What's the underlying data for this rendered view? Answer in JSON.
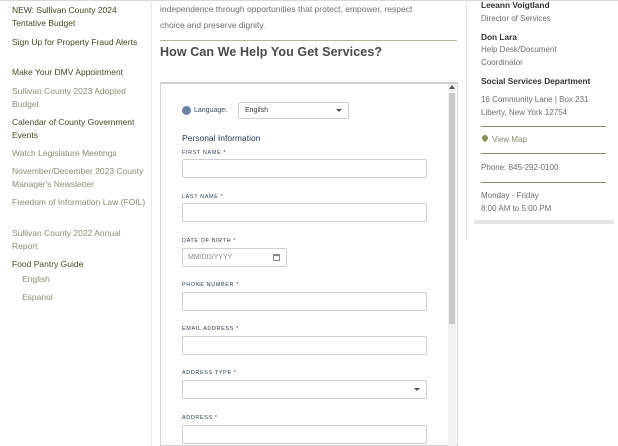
{
  "sidebar": {
    "items": [
      {
        "label": "NEW: Sullivan County 2024 Tentative Budget",
        "style": "dark"
      },
      {
        "label": "Sign Up for Property Fraud Alerts",
        "style": "dark"
      },
      {
        "label": "Make Your DMV Appointment",
        "style": "dark"
      },
      {
        "label": "Sullivan County 2023 Adopted Budget",
        "style": "light"
      },
      {
        "label": "Calendar of County Government Events",
        "style": "dark"
      },
      {
        "label": "Watch Legislature Meetings",
        "style": "light"
      },
      {
        "label": "November/December 2023 County Manager's Newsletter",
        "style": "light"
      },
      {
        "label": "Freedom of Information Law (FOIL)",
        "style": "light"
      },
      {
        "label": "Sullivan County 2022 Annual Report",
        "style": "light"
      },
      {
        "label": "Food Pantry Guide",
        "style": "dark"
      }
    ],
    "subitems": [
      {
        "label": "English"
      },
      {
        "label": "Espanol"
      }
    ]
  },
  "main": {
    "intro_line1": "independence through opportunities that protect, empower, respect",
    "intro_line2": "choice and preserve dignity.",
    "help_title": "How Can We Help You Get Services?"
  },
  "form": {
    "language_label": "Language:",
    "language_value": "English",
    "section_title": "Personal Information",
    "fields": {
      "first_name": "FIRST NAME *",
      "last_name": "LAST NAME *",
      "dob": "DATE OF BIRTH *",
      "dob_placeholder": "MM/DD/YYYY",
      "phone": "PHONE NUMBER *",
      "email": "EMAIL ADDRESS *",
      "address_type": "ADDRESS TYPE *",
      "address": "ADDRESS *"
    }
  },
  "contact": {
    "person1_name": "Leeann Voigtland",
    "person1_title": "Director of Services",
    "person2_name": "Don Lara",
    "person2_title_line1": "Help Desk/Document",
    "person2_title_line2": "Coordinator",
    "department": "Social Services Department",
    "address_line1": "16 Community Lane | Box 231",
    "address_line2": "Liberty, New York 12754",
    "map_link": "View Map",
    "phone": "Phone: 845-292-0100",
    "hours_days": "Monday - Friday",
    "hours_time": "8:00 AM to 5:00 PM"
  },
  "colors": {
    "accent_olive": "#3e4a25",
    "muted_link": "#8b8d78",
    "form_label_navy": "#2e3d57"
  },
  "icons": {
    "globe": "globe-icon",
    "dropdown": "chevron-down-icon",
    "calendar": "calendar-icon",
    "map_pin": "map-pin-icon"
  }
}
